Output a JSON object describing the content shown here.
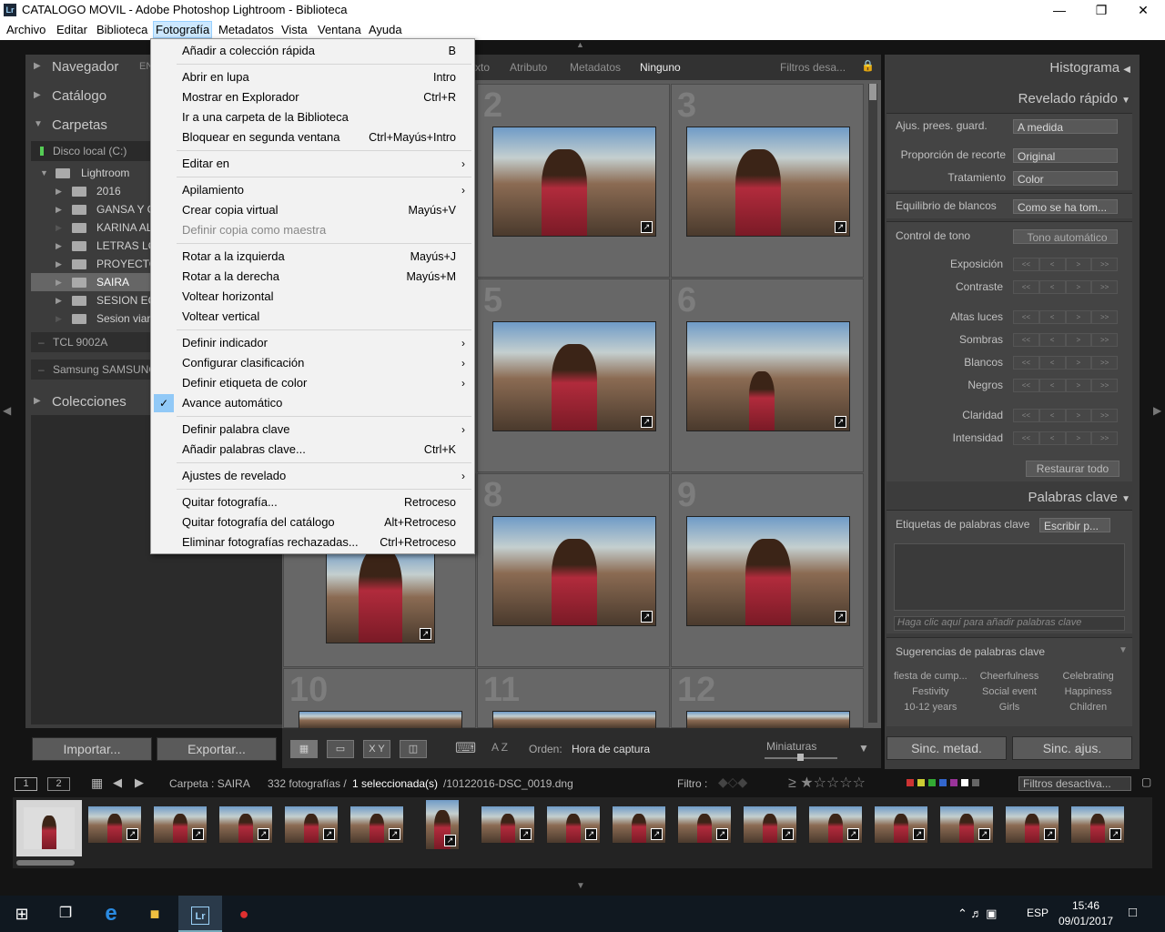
{
  "title": "CATALOGO MOVIL - Adobe Photoshop Lightroom - Biblioteca",
  "title_icon": "Lr",
  "menubar": [
    "Archivo",
    "Editar",
    "Biblioteca",
    "Fotografía",
    "Metadatos",
    "Vista",
    "Ventana",
    "Ayuda"
  ],
  "left": {
    "navegador": "Navegador",
    "nav_extra": "EN",
    "catalogo": "Catálogo",
    "carpetas": "Carpetas",
    "disk": "Disco local (C:)",
    "folders": [
      "Lightroom",
      "2016",
      "GANSA Y G",
      "KARINA AL",
      "LETRAS LO",
      "PROYECTO",
      "SAIRA",
      "SESION EQU",
      "Sesion vian"
    ],
    "devices": [
      "TCL 9002A",
      "Samsung SAMSUNG"
    ],
    "colecciones": "Colecciones",
    "importar": "Importar...",
    "exportar": "Exportar..."
  },
  "filterbar": {
    "texto": "xto",
    "atributo": "Atributo",
    "metadatos": "Metadatos",
    "ninguno": "Ninguno",
    "filtros": "Filtros desa..."
  },
  "grid_numbers": [
    "2",
    "3",
    "5",
    "6",
    "8",
    "9",
    "10",
    "11",
    "12"
  ],
  "toolbar": {
    "orden_label": "Orden:",
    "orden_value": "Hora de captura",
    "miniaturas": "Miniaturas",
    "xy": "X Y",
    "az": "A Z"
  },
  "right": {
    "histograma": "Histograma",
    "revelado": "Revelado rápido",
    "ajus": "Ajus. prees. guard.",
    "ajus_val": "A medida",
    "proporcion": "Proporción de recorte",
    "proporcion_val": "Original",
    "tratamiento": "Tratamiento",
    "tratamiento_val": "Color",
    "equilibrio": "Equilibrio de blancos",
    "equilibrio_val": "Como se ha tom...",
    "control": "Control de tono",
    "tono_auto": "Tono automático",
    "sliders": [
      "Exposición",
      "Contraste",
      "Altas luces",
      "Sombras",
      "Blancos",
      "Negros",
      "Claridad",
      "Intensidad"
    ],
    "restaurar": "Restaurar todo",
    "palabras": "Palabras clave",
    "etiquetas": "Etiquetas de palabras clave",
    "escribir": "Escribir p...",
    "placeholder": "Haga clic aquí para añadir palabras clave",
    "sugerencias": "Sugerencias de palabras clave",
    "suggest": [
      "fiesta de cump...",
      "Cheerfulness",
      "Celebrating",
      "Festivity",
      "Social event",
      "Happiness",
      "10-12 years",
      "Girls",
      "Children"
    ],
    "sinc_metad": "Sinc. metad.",
    "sinc_ajus": "Sinc. ajus."
  },
  "filmbar": {
    "b1": "1",
    "b2": "2",
    "carpeta": "Carpeta : SAIRA",
    "count": "332 fotografías /",
    "sel": "1 seleccionada(s)",
    "file": "/10122016-DSC_0019.dng",
    "filtro": "Filtro :",
    "filtros_off": "Filtros desactiva..."
  },
  "menu": {
    "items": [
      {
        "l": "Añadir a colección rápida",
        "r": "B"
      },
      {
        "sep": true
      },
      {
        "l": "Abrir en lupa",
        "r": "Intro"
      },
      {
        "l": "Mostrar en Explorador",
        "r": "Ctrl+R"
      },
      {
        "l": "Ir a una carpeta de la Biblioteca",
        "r": ""
      },
      {
        "l": "Bloquear en segunda ventana",
        "r": "Ctrl+Mayús+Intro"
      },
      {
        "sep": true
      },
      {
        "l": "Editar en",
        "sub": true
      },
      {
        "sep": true
      },
      {
        "l": "Apilamiento",
        "sub": true
      },
      {
        "l": "Crear copia virtual",
        "r": "Mayús+V"
      },
      {
        "l": "Definir copia como maestra",
        "dis": true
      },
      {
        "sep": true
      },
      {
        "l": "Rotar a la izquierda",
        "r": "Mayús+J"
      },
      {
        "l": "Rotar a la derecha",
        "r": "Mayús+M"
      },
      {
        "l": "Voltear horizontal",
        "r": ""
      },
      {
        "l": "Voltear vertical",
        "r": ""
      },
      {
        "sep": true
      },
      {
        "l": "Definir indicador",
        "sub": true
      },
      {
        "l": "Configurar clasificación",
        "sub": true
      },
      {
        "l": "Definir etiqueta de color",
        "sub": true
      },
      {
        "l": "Avance automático",
        "check": true
      },
      {
        "sep": true
      },
      {
        "l": "Definir palabra clave",
        "sub": true
      },
      {
        "l": "Añadir palabras clave...",
        "r": "Ctrl+K"
      },
      {
        "sep": true
      },
      {
        "l": "Ajustes de revelado",
        "sub": true
      },
      {
        "sep": true
      },
      {
        "l": "Quitar fotografía...",
        "r": "Retroceso"
      },
      {
        "l": "Quitar fotografía del catálogo",
        "r": "Alt+Retroceso"
      },
      {
        "l": "Eliminar fotografías rechazadas...",
        "r": "Ctrl+Retroceso"
      }
    ]
  },
  "taskbar": {
    "lang": "ESP",
    "time": "15:46",
    "date": "09/01/2017"
  }
}
